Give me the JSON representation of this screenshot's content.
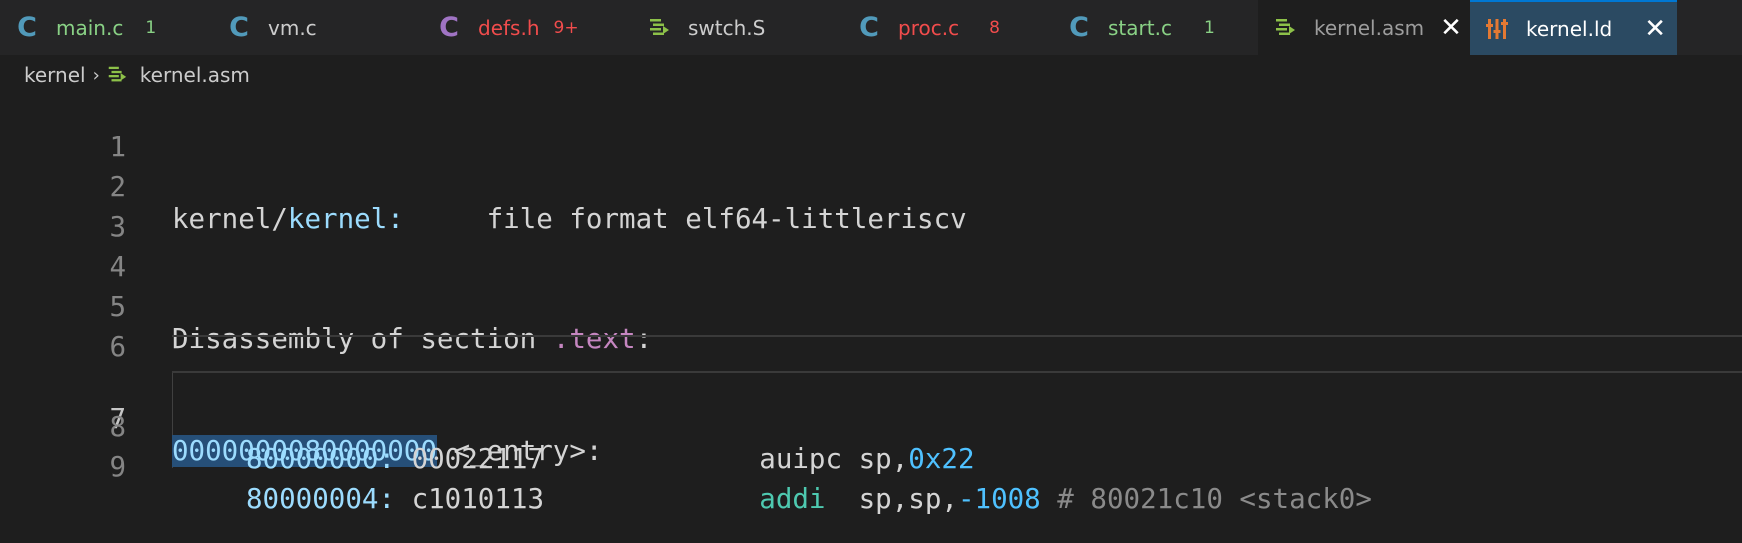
{
  "tabs": [
    {
      "label": "main.c",
      "badge": "1",
      "icon": "c-file-icon",
      "label_color": "#89d185",
      "badge_color": "#89d185",
      "icon_color": "#519aba"
    },
    {
      "label": "vm.c",
      "badge": "",
      "icon": "c-file-icon",
      "label_color": "#cccccc",
      "badge_color": "#cccccc",
      "icon_color": "#519aba"
    },
    {
      "label": "defs.h",
      "badge": "9+",
      "icon": "c-header-icon",
      "label_color": "#f14c4c",
      "badge_color": "#f14c4c",
      "icon_color": "#a074c4"
    },
    {
      "label": "swtch.S",
      "badge": "",
      "icon": "asm-file-icon",
      "label_color": "#cccccc",
      "badge_color": "#cccccc",
      "icon_color": "#8dc149"
    },
    {
      "label": "proc.c",
      "badge": "8",
      "icon": "c-file-icon",
      "label_color": "#f14c4c",
      "badge_color": "#f14c4c",
      "icon_color": "#519aba"
    },
    {
      "label": "start.c",
      "badge": "1",
      "icon": "c-file-icon",
      "label_color": "#89d185",
      "badge_color": "#89d185",
      "icon_color": "#519aba"
    },
    {
      "label": "kernel.asm",
      "badge": "",
      "icon": "asm-file-icon",
      "label_color": "#9d9d9d",
      "badge_color": "#9d9d9d",
      "icon_color": "#8dc149",
      "close": "✕"
    },
    {
      "label": "kernel.ld",
      "badge": "",
      "icon": "linker-file-icon",
      "label_color": "#ffffff",
      "badge_color": "#ffffff",
      "icon_color": "#e37933",
      "close": "✕"
    }
  ],
  "breadcrumb": {
    "folder": "kernel",
    "separator": "›",
    "file": "kernel.asm"
  },
  "editor": {
    "current_line": "7",
    "lines": [
      {
        "n": "1"
      },
      {
        "n": "2",
        "a": "kernel/",
        "b": "kernel:",
        "c": "     file format elf64-littleriscv"
      },
      {
        "n": "3"
      },
      {
        "n": "4"
      },
      {
        "n": "5",
        "a": "Disassembly of section ",
        "b": ".text",
        ":": ":"
      },
      {
        "n": "6"
      },
      {
        "n": "7",
        "a": "0000000080000000",
        "b": " <_entry>:"
      },
      {
        "n": "8",
        "addr": "80000000:",
        "hex": " 00022117",
        "op": "             auipc",
        "args": " sp,",
        "imm": "0x22"
      },
      {
        "n": "9",
        "addr": "80000004:",
        "hex": " c1010113",
        "op": "             addi",
        "args": "  sp,sp,",
        "imm": "-1008",
        "cmt": " # 80021c10 <stack0>"
      }
    ]
  }
}
